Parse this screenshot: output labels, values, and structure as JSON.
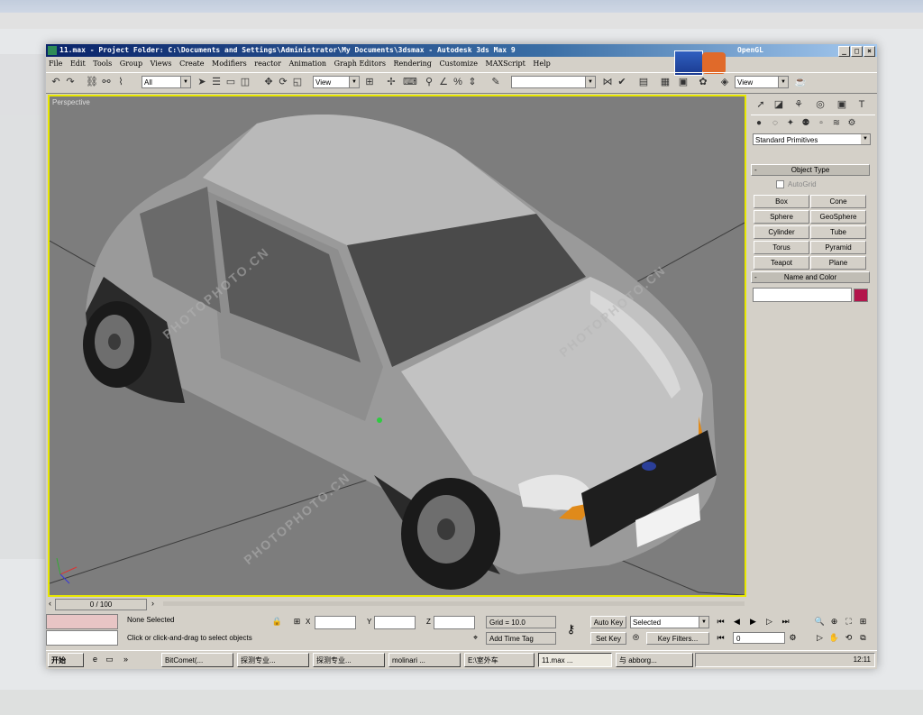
{
  "window": {
    "title": "11.max - Project Folder: C:\\Documents and Settings\\Administrator\\My Documents\\3dsmax - Autodesk 3ds Max 9",
    "renderer": "OpenGL",
    "controls": [
      "_",
      "□",
      "×"
    ]
  },
  "menu": [
    "File",
    "Edit",
    "Tools",
    "Group",
    "Views",
    "Create",
    "Modifiers",
    "reactor",
    "Animation",
    "Graph Editors",
    "Rendering",
    "Customize",
    "MAXScript",
    "Help"
  ],
  "toolbar": {
    "filter": "All",
    "refcoord": "View",
    "named_selection": "",
    "view_select": "View"
  },
  "viewport": {
    "label": "Perspective"
  },
  "command_panel": {
    "category": "Standard Primitives",
    "object_type_header": "Object Type",
    "autogrid": "AutoGrid",
    "primitives": [
      "Box",
      "Cone",
      "Sphere",
      "GeoSphere",
      "Cylinder",
      "Tube",
      "Torus",
      "Pyramid",
      "Teapot",
      "Plane"
    ],
    "name_color_header": "Name and Color",
    "object_color": "#b3154b"
  },
  "timeline": {
    "frame": "0 / 100"
  },
  "status": {
    "selection": "None Selected",
    "prompt": "Click or click-and-drag to select objects",
    "x_label": "X",
    "y_label": "Y",
    "z_label": "Z",
    "grid": "Grid = 10.0",
    "add_time_tag": "Add Time Tag",
    "auto_key": "Auto Key",
    "set_key": "Set Key",
    "key_mode": "Selected",
    "key_filters": "Key Filters...",
    "current_frame": "0"
  },
  "taskbar": {
    "start": "开始",
    "items": [
      "BitComet(...",
      "探测专业...",
      "探测专业...",
      "molinari ...",
      "E:\\室外车",
      "11.max ...",
      "与 abborg..."
    ],
    "clock": "12:11"
  },
  "watermark": {
    "text": "PHOTOPHOTO.CN",
    "cn": "图行天下"
  }
}
